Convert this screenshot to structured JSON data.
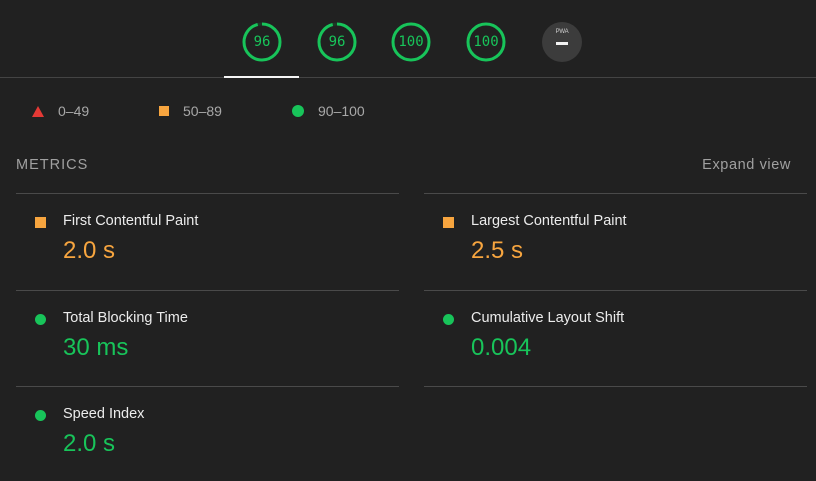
{
  "scores": [
    {
      "value": "96",
      "fraction": 0.96,
      "color": "#18c45a"
    },
    {
      "value": "96",
      "fraction": 0.96,
      "color": "#18c45a"
    },
    {
      "value": "100",
      "fraction": 1.0,
      "color": "#18c45a"
    },
    {
      "value": "100",
      "fraction": 1.0,
      "color": "#18c45a"
    }
  ],
  "pwa": {
    "label": "PWA",
    "icon": "pwa-dash-icon"
  },
  "legend": [
    {
      "icon": "triangle-icon",
      "color": "#e53935",
      "label": "0–49"
    },
    {
      "icon": "square-icon",
      "color": "#f7a53f",
      "label": "50–89"
    },
    {
      "icon": "circle-icon",
      "color": "#18c45a",
      "label": "90–100"
    }
  ],
  "metrics_title": "METRICS",
  "expand_label": "Expand view",
  "metrics": [
    {
      "label": "First Contentful Paint",
      "value": "2.0 s",
      "status": "average",
      "icon": "square-icon",
      "color": "#f7a53f"
    },
    {
      "label": "Largest Contentful Paint",
      "value": "2.5 s",
      "status": "average",
      "icon": "square-icon",
      "color": "#f7a53f"
    },
    {
      "label": "Total Blocking Time",
      "value": "30 ms",
      "status": "pass",
      "icon": "circle-icon",
      "color": "#18c45a"
    },
    {
      "label": "Cumulative Layout Shift",
      "value": "0.004",
      "status": "pass",
      "icon": "circle-icon",
      "color": "#18c45a"
    },
    {
      "label": "Speed Index",
      "value": "2.0 s",
      "status": "pass",
      "icon": "circle-icon",
      "color": "#18c45a"
    }
  ]
}
